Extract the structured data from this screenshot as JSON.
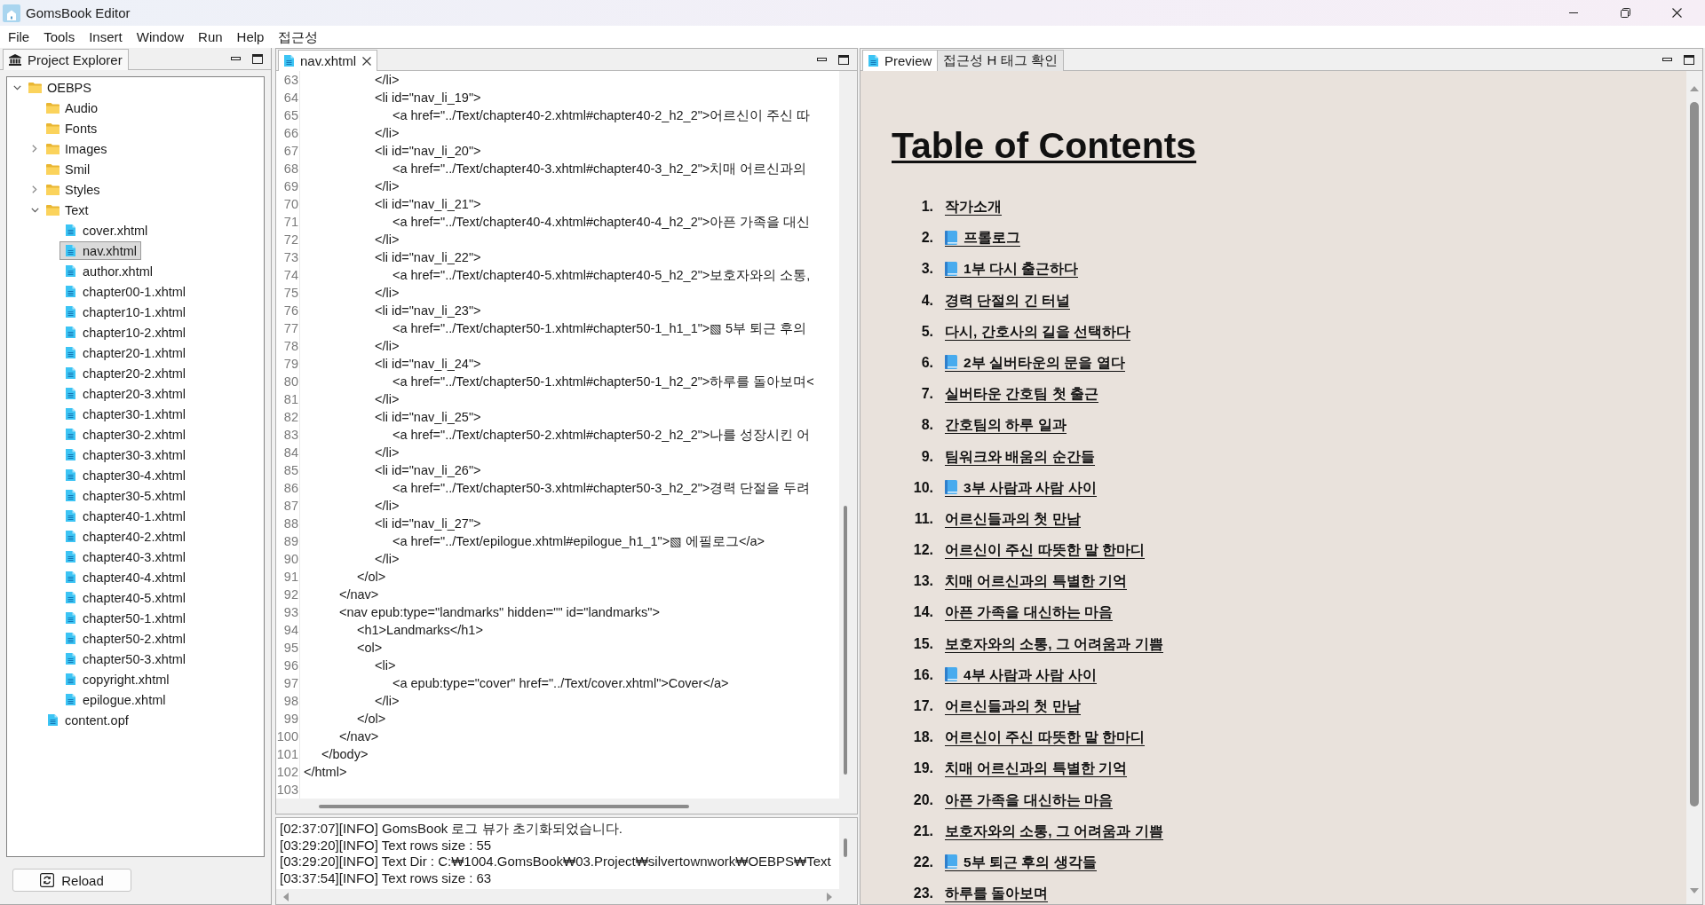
{
  "window": {
    "title": "GomsBook Editor"
  },
  "menu": [
    "File",
    "Tools",
    "Insert",
    "Window",
    "Run",
    "Help",
    "접근성"
  ],
  "project_explorer": {
    "tab": "Project Explorer",
    "tree": [
      {
        "label": "OEBPS",
        "kind": "folder",
        "expanded": true,
        "selected": false,
        "children": [
          {
            "label": "Audio",
            "kind": "folder",
            "selected": false
          },
          {
            "label": "Fonts",
            "kind": "folder",
            "selected": false
          },
          {
            "label": "Images",
            "kind": "folder",
            "expanded": false,
            "selected": false
          },
          {
            "label": "Smil",
            "kind": "folder",
            "selected": false
          },
          {
            "label": "Styles",
            "kind": "folder",
            "expanded": false,
            "selected": false
          },
          {
            "label": "Text",
            "kind": "folder",
            "expanded": true,
            "selected": false,
            "children": [
              {
                "label": "cover.xhtml",
                "kind": "file",
                "selected": false
              },
              {
                "label": "nav.xhtml",
                "kind": "file",
                "selected": true
              },
              {
                "label": "author.xhtml",
                "kind": "file",
                "selected": false
              },
              {
                "label": "chapter00-1.xhtml",
                "kind": "file",
                "selected": false
              },
              {
                "label": "chapter10-1.xhtml",
                "kind": "file",
                "selected": false
              },
              {
                "label": "chapter10-2.xhtml",
                "kind": "file",
                "selected": false
              },
              {
                "label": "chapter20-1.xhtml",
                "kind": "file",
                "selected": false
              },
              {
                "label": "chapter20-2.xhtml",
                "kind": "file",
                "selected": false
              },
              {
                "label": "chapter20-3.xhtml",
                "kind": "file",
                "selected": false
              },
              {
                "label": "chapter30-1.xhtml",
                "kind": "file",
                "selected": false
              },
              {
                "label": "chapter30-2.xhtml",
                "kind": "file",
                "selected": false
              },
              {
                "label": "chapter30-3.xhtml",
                "kind": "file",
                "selected": false
              },
              {
                "label": "chapter30-4.xhtml",
                "kind": "file",
                "selected": false
              },
              {
                "label": "chapter30-5.xhtml",
                "kind": "file",
                "selected": false
              },
              {
                "label": "chapter40-1.xhtml",
                "kind": "file",
                "selected": false
              },
              {
                "label": "chapter40-2.xhtml",
                "kind": "file",
                "selected": false
              },
              {
                "label": "chapter40-3.xhtml",
                "kind": "file",
                "selected": false
              },
              {
                "label": "chapter40-4.xhtml",
                "kind": "file",
                "selected": false
              },
              {
                "label": "chapter40-5.xhtml",
                "kind": "file",
                "selected": false
              },
              {
                "label": "chapter50-1.xhtml",
                "kind": "file",
                "selected": false
              },
              {
                "label": "chapter50-2.xhtml",
                "kind": "file",
                "selected": false
              },
              {
                "label": "chapter50-3.xhtml",
                "kind": "file",
                "selected": false
              },
              {
                "label": "copyright.xhtml",
                "kind": "file",
                "selected": false
              },
              {
                "label": "epilogue.xhtml",
                "kind": "file",
                "selected": false
              }
            ]
          },
          {
            "label": "content.opf",
            "kind": "file",
            "selected": false
          }
        ]
      }
    ],
    "reload_button": "Reload"
  },
  "editor": {
    "tabs": [
      {
        "label": "nav.xhtml",
        "kind": "file",
        "selected": true,
        "closable": true
      }
    ],
    "lines": [
      {
        "number": "63",
        "text": "\t\t\t\t</li>"
      },
      {
        "number": "64",
        "text": "\t\t\t\t<li id=\"nav_li_19\">"
      },
      {
        "number": "65",
        "text": "\t\t\t\t\t<a href=\"../Text/chapter40-2.xhtml#chapter40-2_h2_2\">어르신이 주신 따"
      },
      {
        "number": "66",
        "text": "\t\t\t\t</li>"
      },
      {
        "number": "67",
        "text": "\t\t\t\t<li id=\"nav_li_20\">"
      },
      {
        "number": "68",
        "text": "\t\t\t\t\t<a href=\"../Text/chapter40-3.xhtml#chapter40-3_h2_2\">치매 어르신과의"
      },
      {
        "number": "69",
        "text": "\t\t\t\t</li>"
      },
      {
        "number": "70",
        "text": "\t\t\t\t<li id=\"nav_li_21\">"
      },
      {
        "number": "71",
        "text": "\t\t\t\t\t<a href=\"../Text/chapter40-4.xhtml#chapter40-4_h2_2\">아픈 가족을 대신"
      },
      {
        "number": "72",
        "text": "\t\t\t\t</li>"
      },
      {
        "number": "73",
        "text": "\t\t\t\t<li id=\"nav_li_22\">"
      },
      {
        "number": "74",
        "text": "\t\t\t\t\t<a href=\"../Text/chapter40-5.xhtml#chapter40-5_h2_2\">보호자와의 소통,"
      },
      {
        "number": "75",
        "text": "\t\t\t\t</li>"
      },
      {
        "number": "76",
        "text": "\t\t\t\t<li id=\"nav_li_23\">"
      },
      {
        "number": "77",
        "text": "\t\t\t\t\t<a href=\"../Text/chapter50-1.xhtml#chapter50-1_h1_1\">▧ 5부 퇴근 후의"
      },
      {
        "number": "78",
        "text": "\t\t\t\t</li>"
      },
      {
        "number": "79",
        "text": "\t\t\t\t<li id=\"nav_li_24\">"
      },
      {
        "number": "80",
        "text": "\t\t\t\t\t<a href=\"../Text/chapter50-1.xhtml#chapter50-1_h2_2\">하루를 돌아보며<"
      },
      {
        "number": "81",
        "text": "\t\t\t\t</li>"
      },
      {
        "number": "82",
        "text": "\t\t\t\t<li id=\"nav_li_25\">"
      },
      {
        "number": "83",
        "text": "\t\t\t\t\t<a href=\"../Text/chapter50-2.xhtml#chapter50-2_h2_2\">나를 성장시킨 어"
      },
      {
        "number": "84",
        "text": "\t\t\t\t</li>"
      },
      {
        "number": "85",
        "text": "\t\t\t\t<li id=\"nav_li_26\">"
      },
      {
        "number": "86",
        "text": "\t\t\t\t\t<a href=\"../Text/chapter50-3.xhtml#chapter50-3_h2_2\">경력 단절을 두려"
      },
      {
        "number": "87",
        "text": "\t\t\t\t</li>"
      },
      {
        "number": "88",
        "text": "\t\t\t\t<li id=\"nav_li_27\">"
      },
      {
        "number": "89",
        "text": "\t\t\t\t\t<a href=\"../Text/epilogue.xhtml#epilogue_h1_1\">▧ 에필로그</a>"
      },
      {
        "number": "90",
        "text": "\t\t\t\t</li>"
      },
      {
        "number": "91",
        "text": "\t\t\t</ol>"
      },
      {
        "number": "92",
        "text": "\t\t</nav>"
      },
      {
        "number": "93",
        "text": "\t\t<nav epub:type=\"landmarks\" hidden=\"\" id=\"landmarks\">"
      },
      {
        "number": "94",
        "text": "\t\t\t<h1>Landmarks</h1>"
      },
      {
        "number": "95",
        "text": "\t\t\t<ol>"
      },
      {
        "number": "96",
        "text": "\t\t\t\t<li>"
      },
      {
        "number": "97",
        "text": "\t\t\t\t\t<a epub:type=\"cover\" href=\"../Text/cover.xhtml\">Cover</a>"
      },
      {
        "number": "98",
        "text": "\t\t\t\t</li>"
      },
      {
        "number": "99",
        "text": "\t\t\t</ol>"
      },
      {
        "number": "100",
        "text": "\t\t</nav>"
      },
      {
        "number": "101",
        "text": "\t</body>"
      },
      {
        "number": "102",
        "text": "</html>"
      },
      {
        "number": "103"
      }
    ]
  },
  "console": {
    "lines": [
      "[02:37:07][INFO] GomsBook 로그 뷰가 초기화되었습니다.",
      "[03:29:20][INFO] Text rows size : 55",
      "[03:29:20][INFO] Text Dir : C:₩1004.GomsBook₩03.Project₩silvertownwork₩OEBPS₩Text",
      "[03:37:54][INFO] Text rows size : 63"
    ]
  },
  "preview": {
    "tabs": [
      {
        "label": "Preview",
        "kind": "file",
        "selected": true
      },
      {
        "label": "접근성 H 태그 확인",
        "kind": "plain",
        "selected": false
      }
    ],
    "heading": "Table of Contents",
    "items": [
      {
        "number": "1.",
        "kind": "chapter",
        "text": "작가소개"
      },
      {
        "number": "2.",
        "kind": "part",
        "text": "프롤로그"
      },
      {
        "number": "3.",
        "kind": "part",
        "text": "1부 다시 출근하다"
      },
      {
        "number": "4.",
        "kind": "chapter",
        "text": "경력 단절의 긴 터널"
      },
      {
        "number": "5.",
        "kind": "chapter",
        "text": "다시, 간호사의 길을 선택하다"
      },
      {
        "number": "6.",
        "kind": "part",
        "text": "2부 실버타운의 문을 열다"
      },
      {
        "number": "7.",
        "kind": "chapter",
        "text": "실버타운 간호팀 첫 출근"
      },
      {
        "number": "8.",
        "kind": "chapter",
        "text": "간호팀의 하루 일과"
      },
      {
        "number": "9.",
        "kind": "chapter",
        "text": "팀워크와 배움의 순간들"
      },
      {
        "number": "10.",
        "kind": "part",
        "text": "3부 사람과 사람 사이"
      },
      {
        "number": "11.",
        "kind": "chapter",
        "text": "어르신들과의 첫 만남"
      },
      {
        "number": "12.",
        "kind": "chapter",
        "text": "어르신이 주신 따뜻한 말 한마디"
      },
      {
        "number": "13.",
        "kind": "chapter",
        "text": "치매 어르신과의 특별한 기억"
      },
      {
        "number": "14.",
        "kind": "chapter",
        "text": "아픈 가족을 대신하는 마음"
      },
      {
        "number": "15.",
        "kind": "chapter",
        "text": "보호자와의 소통, 그 어려움과 기쁨"
      },
      {
        "number": "16.",
        "kind": "part",
        "text": "4부 사람과 사람 사이"
      },
      {
        "number": "17.",
        "kind": "chapter",
        "text": "어르신들과의 첫 만남"
      },
      {
        "number": "18.",
        "kind": "chapter",
        "text": "어르신이 주신 따뜻한 말 한마디"
      },
      {
        "number": "19.",
        "kind": "chapter",
        "text": "치매 어르신과의 특별한 기억"
      },
      {
        "number": "20.",
        "kind": "chapter",
        "text": "아픈 가족을 대신하는 마음"
      },
      {
        "number": "21.",
        "kind": "chapter",
        "text": "보호자와의 소통, 그 어려움과 기쁨"
      },
      {
        "number": "22.",
        "kind": "part",
        "text": "5부 퇴근 후의 생각들"
      },
      {
        "number": "23.",
        "kind": "chapter",
        "text": "하루를 돌아보며"
      }
    ]
  }
}
